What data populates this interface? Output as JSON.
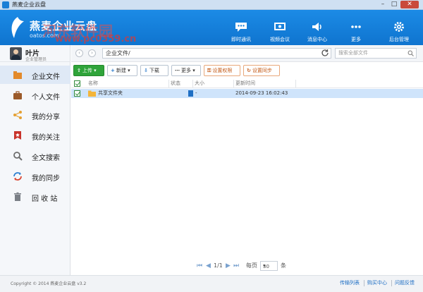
{
  "window": {
    "title": "燕麦企业云盘",
    "minimize": "–",
    "maximize": "□",
    "close": "✕"
  },
  "header": {
    "brand": "燕麦企业云盘",
    "site": "oatos.com",
    "watermark_top": "河东软件园",
    "watermark_url": "www.pc0359.cn",
    "buttons": [
      {
        "label": "即时通讯",
        "icon": "chat-icon"
      },
      {
        "label": "视频会议",
        "icon": "video-icon"
      },
      {
        "label": "消息中心",
        "icon": "speaker-icon"
      },
      {
        "label": "更多",
        "icon": "more-icon"
      },
      {
        "label": "后台管理",
        "icon": "gear-icon"
      }
    ]
  },
  "user": {
    "name": "叶片",
    "role": "企业管理员"
  },
  "sidebar": {
    "items": [
      {
        "label": "企业文件",
        "icon": "enterprise-files-icon",
        "active": true
      },
      {
        "label": "个人文件",
        "icon": "briefcase-icon",
        "active": false
      },
      {
        "label": "我的分享",
        "icon": "share-icon",
        "active": false
      },
      {
        "label": "我的关注",
        "icon": "bookmark-icon",
        "active": false
      },
      {
        "label": "全文搜索",
        "icon": "search-icon",
        "active": false
      },
      {
        "label": "我的同步",
        "icon": "sync-icon",
        "active": false
      },
      {
        "label": "回 收 站",
        "icon": "trash-icon",
        "active": false
      }
    ]
  },
  "addressbar": {
    "path": "企业文件/",
    "search_placeholder": "搜索全部文件"
  },
  "toolbar": {
    "upload": "上传",
    "new": "新建",
    "download": "下载",
    "more": "更多",
    "set_permission": "设置权限",
    "set_sync": "设置同步"
  },
  "table": {
    "columns": [
      "名称",
      "状态",
      "大小",
      "更新时间"
    ],
    "rows": [
      {
        "name": "共享文件夹",
        "status": "",
        "size": "-",
        "updated": "2014-09-23 16:02:43",
        "selected": true
      }
    ]
  },
  "pager": {
    "page": "1/1",
    "per_page_label": "每页",
    "per_page": "30",
    "unit": "条"
  },
  "footer": {
    "copyright": "Copyright © 2014 燕麦企业云盘 v3.2",
    "links": [
      "传输列表",
      "购买中心",
      "问题反馈"
    ]
  },
  "colors": {
    "header": "#1c8be6",
    "active_nav": "#dfe9f6",
    "selected_row": "#cfe4fb",
    "upload_button": "#2fa43a",
    "accent_orange": "#c45c1a"
  }
}
